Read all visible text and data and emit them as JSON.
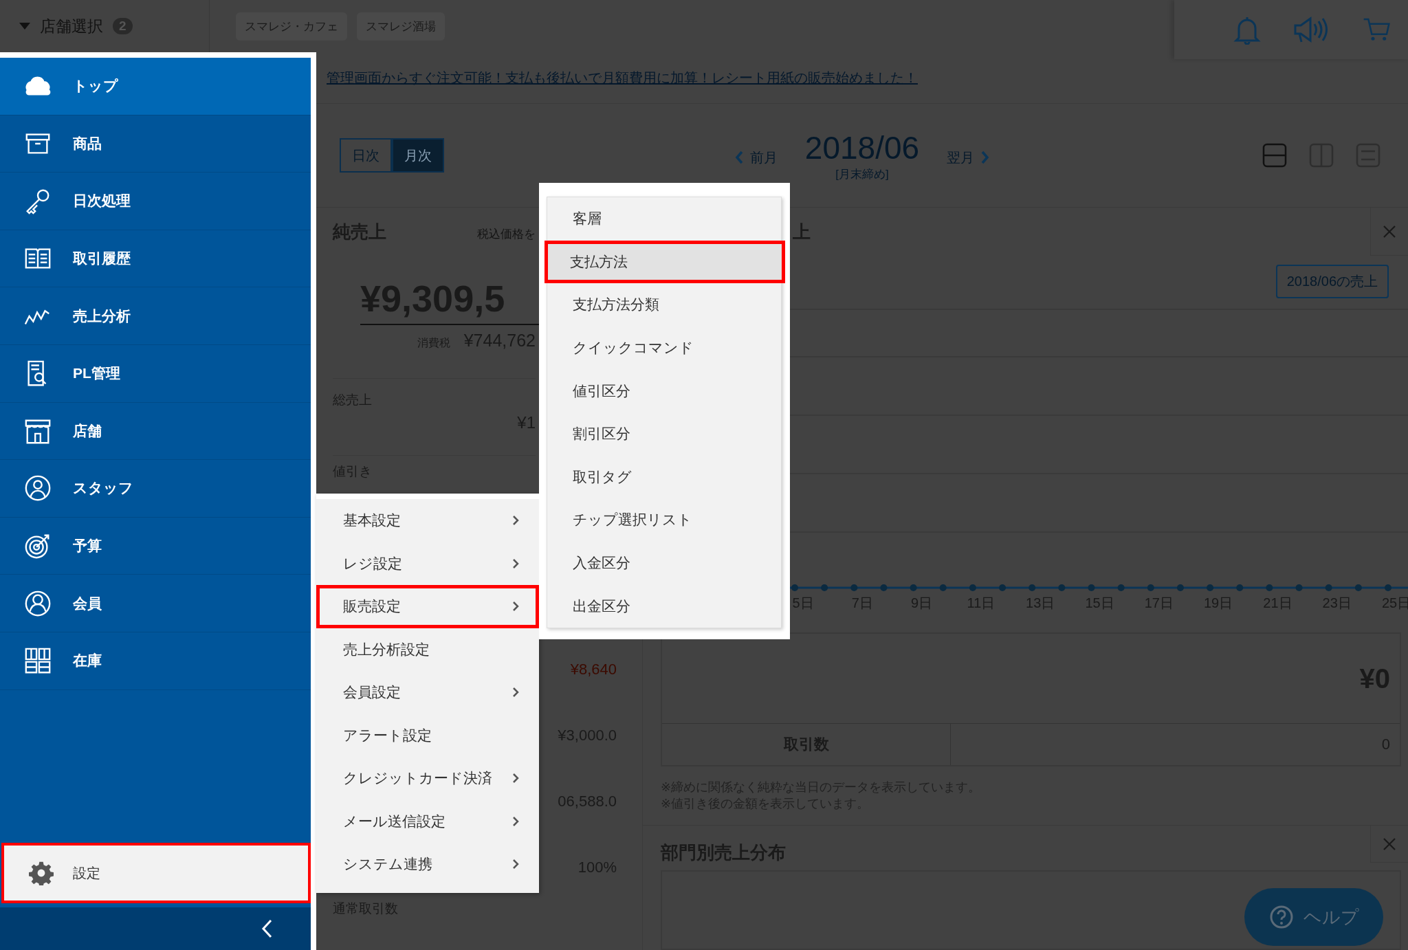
{
  "store_selector": {
    "label": "店舗選択",
    "count": "2"
  },
  "store_tabs": [
    "スマレジ・カフェ",
    "スマレジ酒場"
  ],
  "sidebar": {
    "items": [
      {
        "label": "トップ",
        "selected": true
      },
      {
        "label": "商品",
        "selected": false
      },
      {
        "label": "日次処理",
        "selected": false
      },
      {
        "label": "取引履歴",
        "selected": false
      },
      {
        "label": "売上分析",
        "selected": false
      },
      {
        "label": "PL管理",
        "selected": false
      },
      {
        "label": "店舗",
        "selected": false
      },
      {
        "label": "スタッフ",
        "selected": false
      },
      {
        "label": "予算",
        "selected": false
      },
      {
        "label": "会員",
        "selected": false
      },
      {
        "label": "在庫",
        "selected": false
      }
    ],
    "settings": {
      "label": "設定",
      "selected": true
    }
  },
  "banner": {
    "link": "管理画面からすぐ注文可能！支払も後払いで月額費用に加算！レシート用紙の販売始めました！"
  },
  "period_toggle": [
    {
      "label": "日次",
      "selected": false
    },
    {
      "label": "月次",
      "selected": true
    }
  ],
  "date_nav": {
    "prev": "前月",
    "period": "2018/06",
    "note": "[月末締め]",
    "next": "翌月"
  },
  "layout_buttons": [
    {
      "selected": true
    },
    {
      "selected": false
    },
    {
      "selected": false
    }
  ],
  "net_sales_card": {
    "title": "純売上",
    "tax_note": "税込価格を",
    "amount": "¥9,309,5",
    "tax_label": "消費税",
    "tax_amount": "¥744,762",
    "gross_label": "総売上",
    "gross_value": "¥1",
    "discount_label": "値引き",
    "values": [
      {
        "value": "¥8,640",
        "negative": true
      },
      {
        "value": "¥3,000.0",
        "negative": false
      },
      {
        "value": "06,588.0",
        "negative": false
      },
      {
        "value": "100%",
        "negative": false
      }
    ],
    "footer_label": "通常取引数"
  },
  "sales_card": {
    "title": "上",
    "period_button": "2018/06の売上",
    "x_labels": [
      "5日",
      "7日",
      "9日",
      "11日",
      "13日",
      "15日",
      "17日",
      "19日",
      "21日",
      "23日",
      "25日"
    ],
    "total": "¥0",
    "count_label": "取引数",
    "count_value": "0",
    "notes": [
      "※締めに関係なく純粋な当日のデータを表示しています。",
      "※値引き後の金額を表示しています。"
    ]
  },
  "department_card": {
    "title": "部門別売上分布"
  },
  "help_button": "ヘルプ",
  "settings_menu": {
    "items": [
      {
        "label": "基本設定",
        "has_submenu": true,
        "selected": false
      },
      {
        "label": "レジ設定",
        "has_submenu": true,
        "selected": false
      },
      {
        "label": "販売設定",
        "has_submenu": true,
        "selected": true
      },
      {
        "label": "売上分析設定",
        "has_submenu": false,
        "selected": false
      },
      {
        "label": "会員設定",
        "has_submenu": true,
        "selected": false
      },
      {
        "label": "アラート設定",
        "has_submenu": false,
        "selected": false
      },
      {
        "label": "クレジットカード決済",
        "has_submenu": true,
        "selected": false
      },
      {
        "label": "メール送信設定",
        "has_submenu": true,
        "selected": false
      },
      {
        "label": "システム連携",
        "has_submenu": true,
        "selected": false
      }
    ]
  },
  "sales_settings_menu": {
    "items": [
      {
        "label": "客層",
        "selected": false
      },
      {
        "label": "支払方法",
        "selected": true
      },
      {
        "label": "支払方法分類",
        "selected": false
      },
      {
        "label": "クイックコマンド",
        "selected": false
      },
      {
        "label": "値引区分",
        "selected": false
      },
      {
        "label": "割引区分",
        "selected": false
      },
      {
        "label": "取引タグ",
        "selected": false
      },
      {
        "label": "チップ選択リスト",
        "selected": false
      },
      {
        "label": "入金区分",
        "selected": false
      },
      {
        "label": "出金区分",
        "selected": false
      }
    ]
  }
}
